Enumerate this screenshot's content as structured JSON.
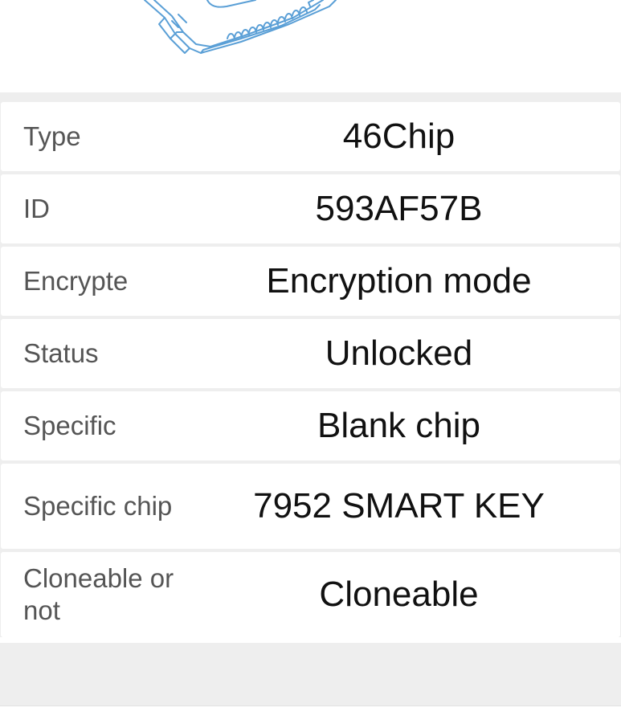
{
  "illustration": {
    "icon": "key-chip-icon",
    "stroke_color": "#5a9fd6"
  },
  "chip_info": {
    "rows": [
      {
        "label": "Type",
        "value": "46Chip"
      },
      {
        "label": "ID",
        "value": "593AF57B"
      },
      {
        "label": "Encrypte",
        "value": "Encryption mode"
      },
      {
        "label": "Status",
        "value": "Unlocked"
      },
      {
        "label": "Specific",
        "value": "Blank chip"
      },
      {
        "label": "Specific chip",
        "value": "7952 SMART KEY"
      },
      {
        "label": "Cloneable or not",
        "value": "Cloneable"
      }
    ]
  }
}
